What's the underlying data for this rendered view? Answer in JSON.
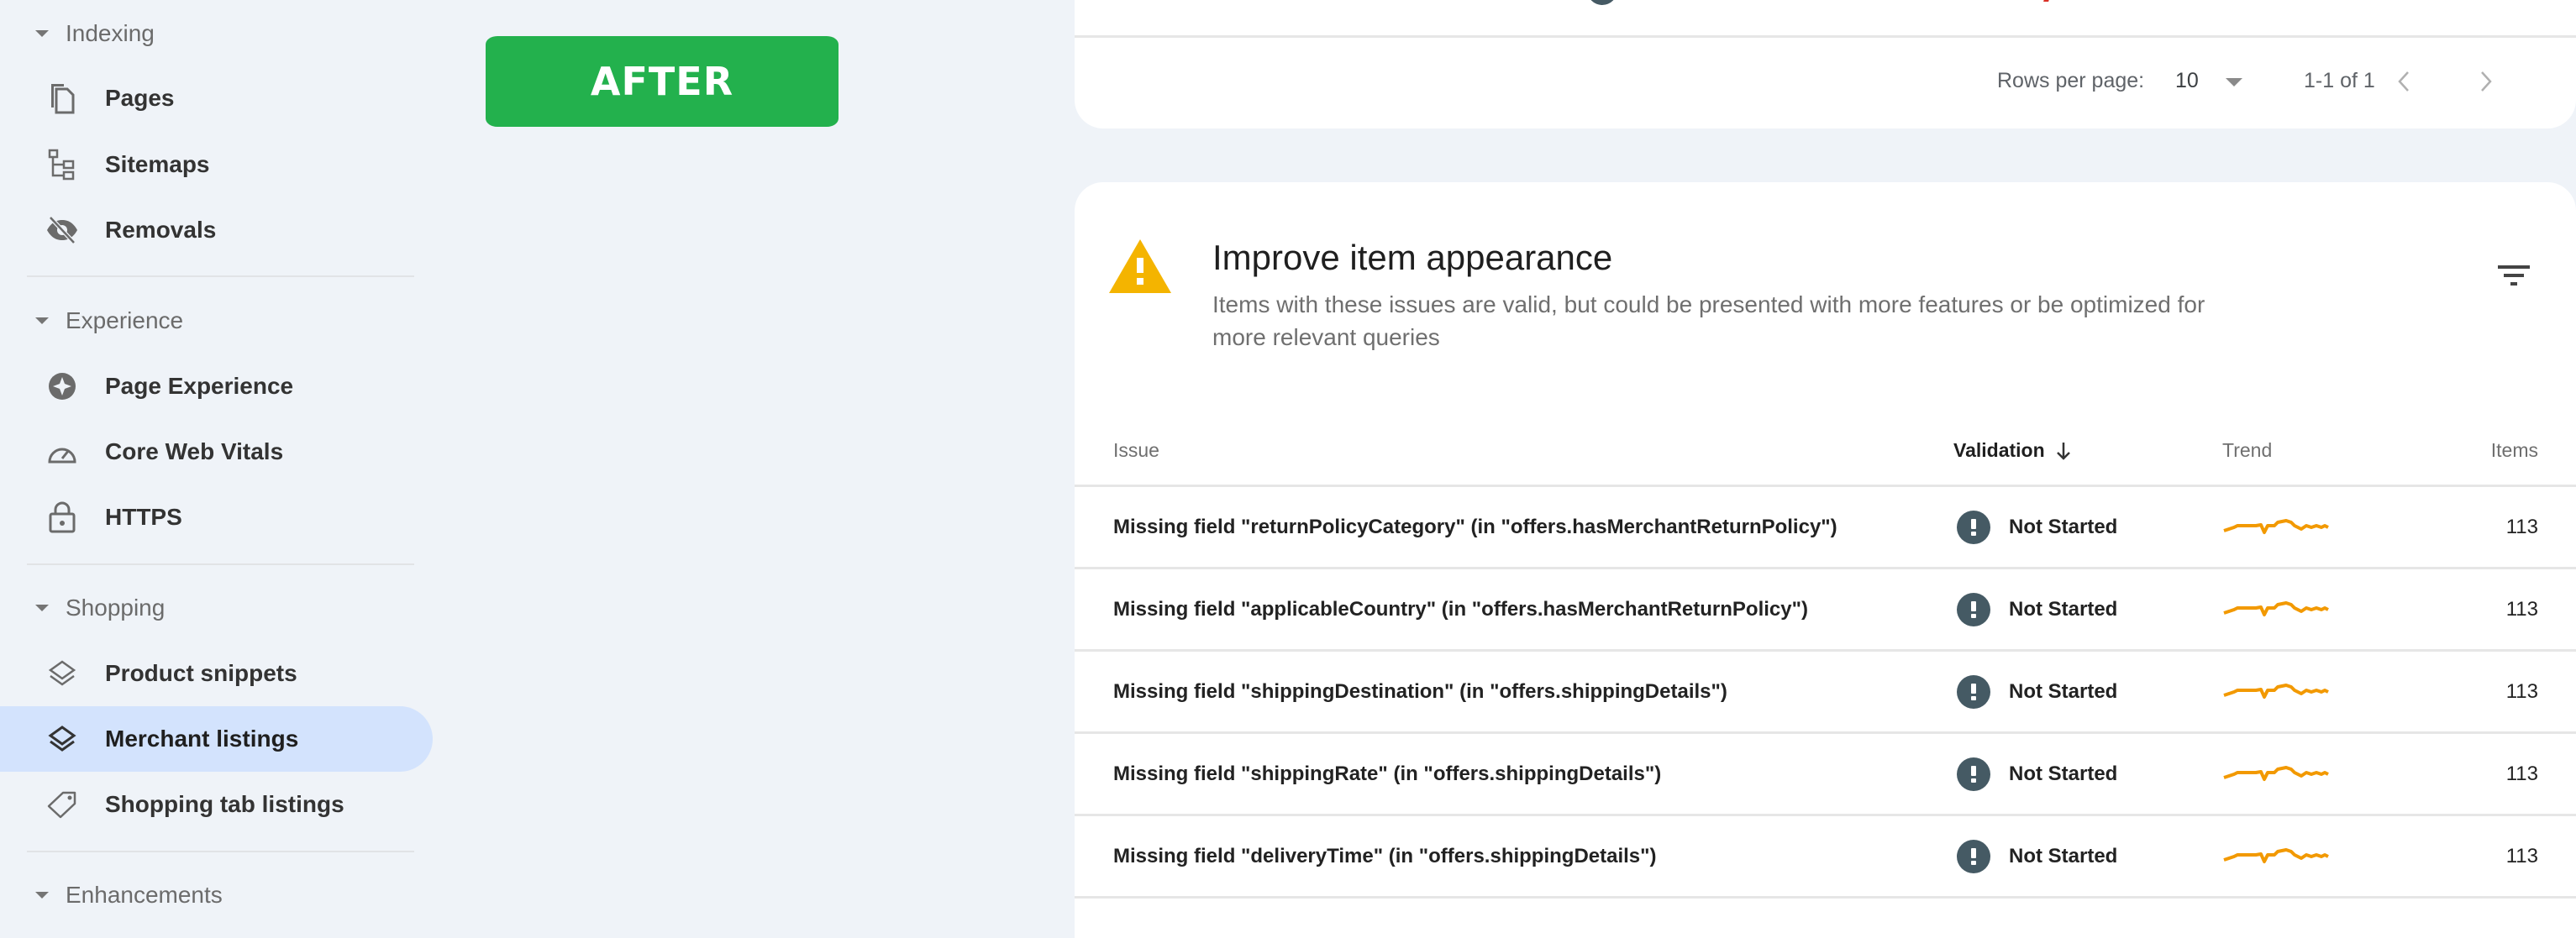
{
  "sidebar": {
    "sections": [
      {
        "label": "Indexing",
        "items": [
          {
            "label": "Pages",
            "icon": "pages-icon"
          },
          {
            "label": "Sitemaps",
            "icon": "sitemaps-icon"
          },
          {
            "label": "Removals",
            "icon": "removals-icon"
          }
        ]
      },
      {
        "label": "Experience",
        "items": [
          {
            "label": "Page Experience",
            "icon": "page-experience-icon"
          },
          {
            "label": "Core Web Vitals",
            "icon": "speedometer-icon"
          },
          {
            "label": "HTTPS",
            "icon": "lock-icon"
          }
        ]
      },
      {
        "label": "Shopping",
        "items": [
          {
            "label": "Product snippets",
            "icon": "layers-outline-icon"
          },
          {
            "label": "Merchant listings",
            "icon": "layers-icon",
            "active": true
          },
          {
            "label": "Shopping tab listings",
            "icon": "tag-icon"
          }
        ]
      },
      {
        "label": "Enhancements",
        "items": []
      }
    ]
  },
  "badge": {
    "label": "AFTER",
    "color": "#23B14D"
  },
  "top_card": {
    "pagination": {
      "rows_per_page_label": "Rows per page:",
      "rows_per_page_value": "10",
      "range": "1-1 of 1"
    }
  },
  "main_card": {
    "title": "Improve item appearance",
    "description": "Items with these issues are valid, but could be presented with more features or be optimized for more relevant queries",
    "warning_color": "#F4B400",
    "table": {
      "columns": {
        "issue": "Issue",
        "validation": "Validation",
        "trend": "Trend",
        "items": "Items"
      },
      "sort": {
        "column": "validation",
        "direction": "descending"
      },
      "trend_color": "#F29900",
      "rows": [
        {
          "issue": "Missing field \"returnPolicyCategory\" (in \"offers.hasMerchantReturnPolicy\")",
          "validation": "Not Started",
          "items": "113"
        },
        {
          "issue": "Missing field \"applicableCountry\" (in \"offers.hasMerchantReturnPolicy\")",
          "validation": "Not Started",
          "items": "113"
        },
        {
          "issue": "Missing field \"shippingDestination\" (in \"offers.shippingDetails\")",
          "validation": "Not Started",
          "items": "113"
        },
        {
          "issue": "Missing field \"shippingRate\" (in \"offers.shippingDetails\")",
          "validation": "Not Started",
          "items": "113"
        },
        {
          "issue": "Missing field \"deliveryTime\" (in \"offers.shippingDetails\")",
          "validation": "Not Started",
          "items": "113"
        }
      ]
    }
  }
}
